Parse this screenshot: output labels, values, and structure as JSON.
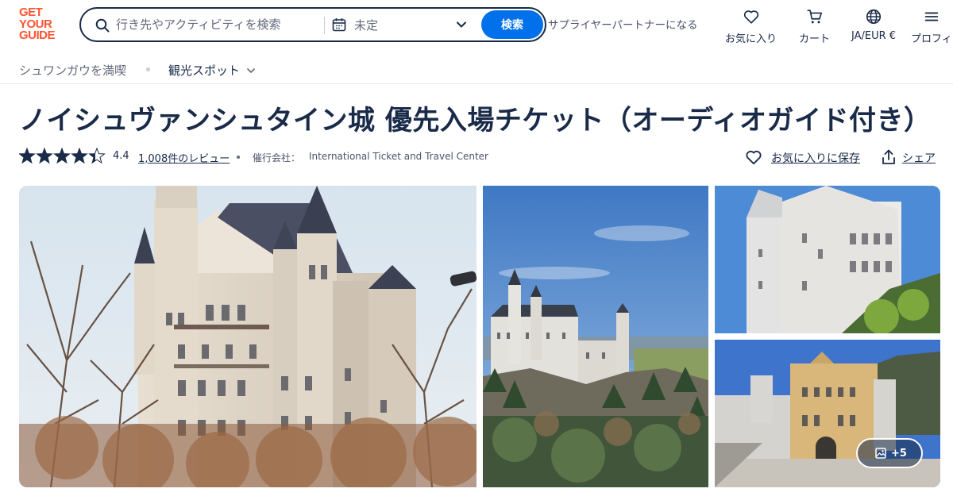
{
  "brand": {
    "logo_lines": [
      "GET",
      "YOUR",
      "GUIDE"
    ],
    "color": "#ff5533"
  },
  "search": {
    "placeholder": "行き先やアクティビティを検索",
    "date_label": "未定",
    "button_label": "検索"
  },
  "header": {
    "partner_link": "サプライヤーパートナーになる",
    "nav": {
      "wishlist": "お気に入り",
      "cart": "カート",
      "language": "JA/EUR €",
      "profile": "プロフィ"
    }
  },
  "subnav": {
    "enjoy": "シュワンガウを満喫",
    "attractions": "観光スポット"
  },
  "product": {
    "title": "ノイシュヴァンシュタイン城 優先入場チケット（オーディオガイド付き）",
    "rating": "4.4",
    "rating_value": 4.4,
    "reviews_link": "1,008件のレビュー",
    "operator_label": "催行会社：",
    "operator_name": "International Ticket and Travel Center",
    "save_label": "お気に入りに保存",
    "share_label": "シェア"
  },
  "gallery": {
    "more_photos_label": "+5"
  },
  "colors": {
    "primary_text": "#1a2b49",
    "accent_blue": "#0071eb",
    "muted_text": "#63687a"
  }
}
